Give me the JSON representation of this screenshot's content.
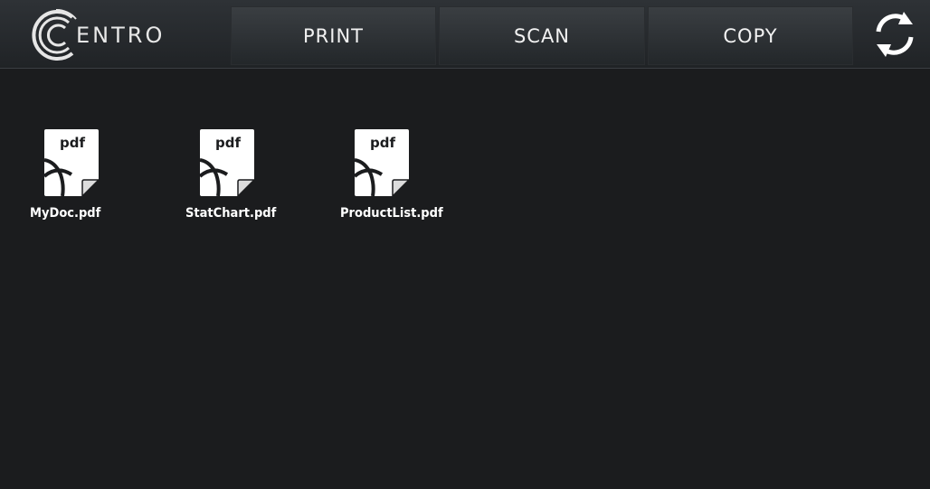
{
  "header": {
    "logo_text": "ENTRO",
    "nav": [
      {
        "label": "PRINT"
      },
      {
        "label": "SCAN"
      },
      {
        "label": "COPY"
      }
    ],
    "refresh_icon": "refresh-icon"
  },
  "files": [
    {
      "name": "MyDoc.pdf",
      "icon_label": "pdf",
      "icon": "pdf-file-icon"
    },
    {
      "name": "StatChart.pdf",
      "icon_label": "pdf",
      "icon": "pdf-file-icon"
    },
    {
      "name": "ProductList.pdf",
      "icon_label": "pdf",
      "icon": "pdf-file-icon"
    }
  ],
  "colors": {
    "background": "#1b1c1e",
    "topbar": "#2a2d31",
    "text": "#ffffff"
  }
}
